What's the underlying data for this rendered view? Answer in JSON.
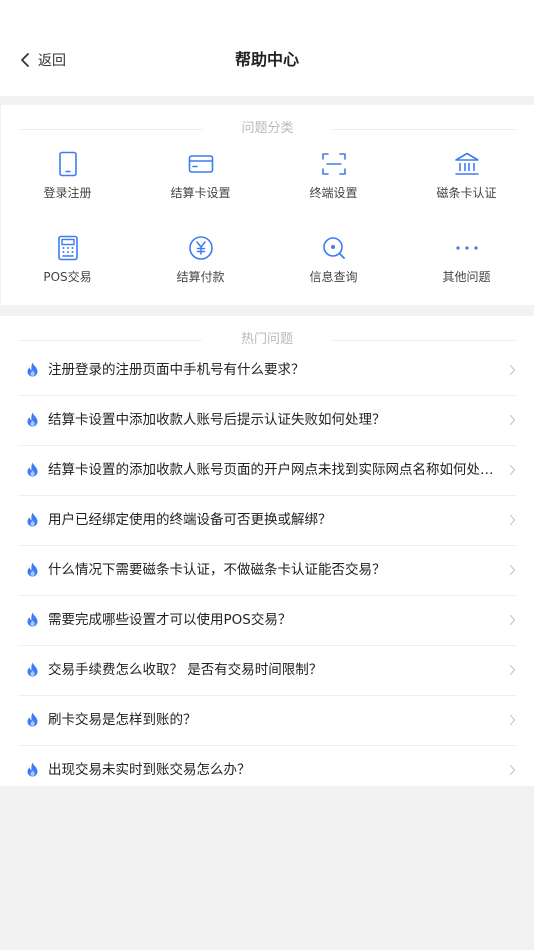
{
  "header": {
    "back_label": "返回",
    "title": "帮助中心"
  },
  "categories": {
    "section_title": "问题分类",
    "accent_color": "#3d7cf2",
    "items": [
      {
        "label": "登录注册",
        "icon": "phone-icon"
      },
      {
        "label": "结算卡设置",
        "icon": "bank-card-icon"
      },
      {
        "label": "终端设置",
        "icon": "scan-frame-icon"
      },
      {
        "label": "磁条卡认证",
        "icon": "bank-building-icon"
      },
      {
        "label": "POS交易",
        "icon": "pos-terminal-icon"
      },
      {
        "label": "结算付款",
        "icon": "yuan-coin-icon"
      },
      {
        "label": "信息查询",
        "icon": "search-icon"
      },
      {
        "label": "其他问题",
        "icon": "more-dots-icon"
      }
    ]
  },
  "hot_questions": {
    "section_title": "热门问题",
    "flame_color": "#3d7cf2",
    "items": [
      {
        "text": "注册登录的注册页面中手机号有什么要求？"
      },
      {
        "text": "结算卡设置中添加收款人账号后提示认证失败如何处理？"
      },
      {
        "text": "结算卡设置的添加收款人账号页面的开户网点未找到实际网点名称如何处理？"
      },
      {
        "text": "用户已经绑定使用的终端设备可否更换或解绑？"
      },
      {
        "text": "什么情况下需要磁条卡认证，不做磁条卡认证能否交易？"
      },
      {
        "text": "需要完成哪些设置才可以使用POS交易？"
      },
      {
        "text": "交易手续费怎么收取？ 是否有交易时间限制？"
      },
      {
        "text": "刷卡交易是怎样到账的？"
      },
      {
        "text": "出现交易未实时到账交易怎么办？"
      }
    ]
  }
}
